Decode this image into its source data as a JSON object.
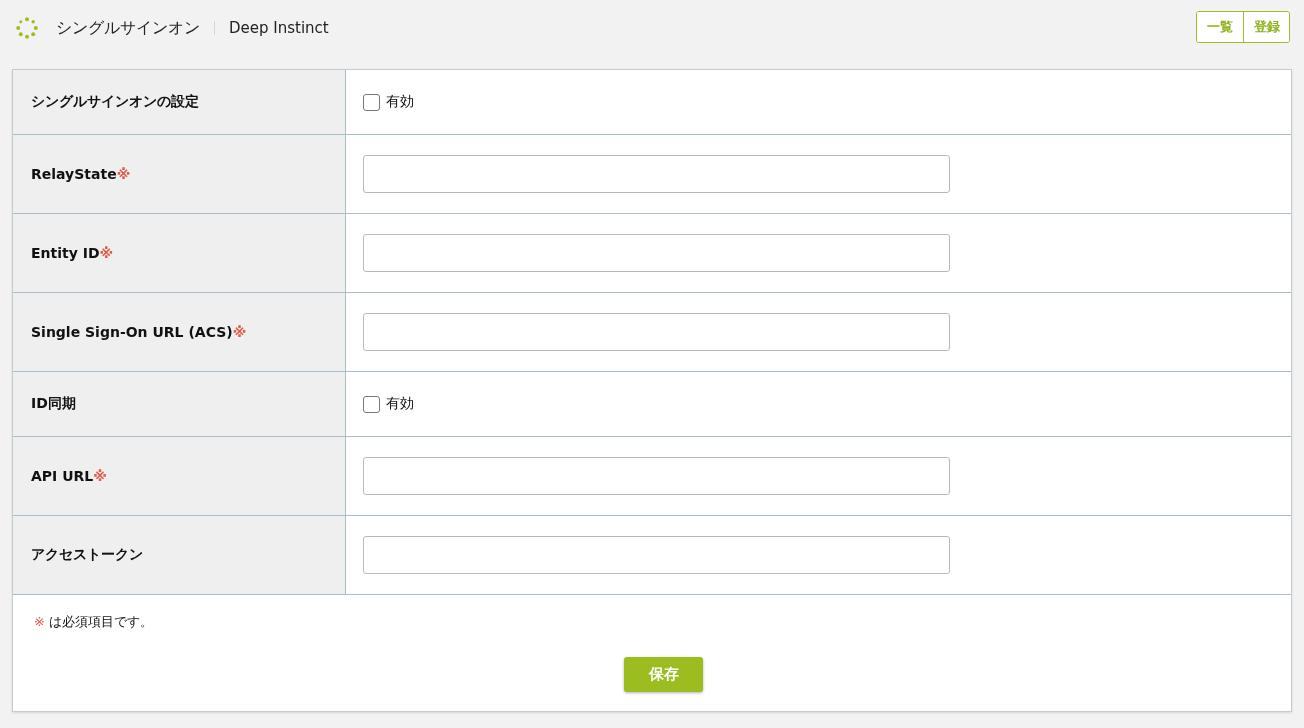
{
  "header": {
    "title": "シングルサインオン",
    "subtitle": "Deep Instinct",
    "buttons": [
      {
        "label": "一覧"
      },
      {
        "label": "登録"
      }
    ]
  },
  "form": {
    "rows": [
      {
        "label": "シングルサインオンの設定",
        "kind": "checkbox",
        "option": "有効",
        "checked": false
      },
      {
        "label": "RelayState",
        "mark": "※",
        "kind": "text"
      },
      {
        "label": "Entity ID",
        "mark": "※",
        "kind": "text"
      },
      {
        "label": "Single Sign-On URL (ACS)",
        "mark": "※",
        "kind": "text"
      },
      {
        "label": "ID同期",
        "kind": "checkbox",
        "option": "有効",
        "checked": false
      },
      {
        "label": "API URL",
        "mark": "※",
        "kind": "text"
      },
      {
        "label": "アクセストークン",
        "kind": "text"
      }
    ]
  },
  "note": {
    "mark": "※",
    "text": "は必須項目です。"
  },
  "save_button": {
    "label": "保存"
  }
}
